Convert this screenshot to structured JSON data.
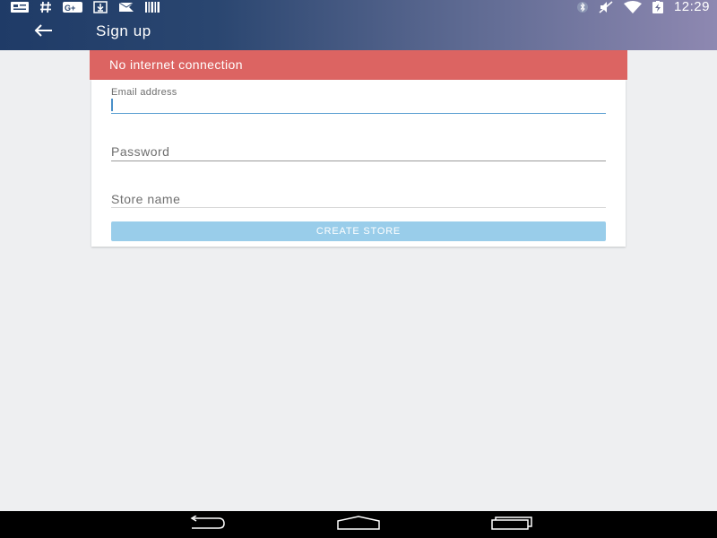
{
  "status_bar": {
    "time": "12:29",
    "left_icons": [
      "message-icon",
      "hashtag-icon",
      "google-plus-icon",
      "download-icon",
      "mail-icon",
      "barcode-icon"
    ],
    "right_icons": [
      "bluetooth-icon",
      "mute-icon",
      "wifi-icon",
      "battery-charging-icon"
    ]
  },
  "app_bar": {
    "title": "Sign up",
    "back_icon": "arrow-left-icon"
  },
  "banner": {
    "message": "No internet connection"
  },
  "form": {
    "email_label": "Email address",
    "email_value": "",
    "password_placeholder": "Password",
    "store_name_placeholder": "Store name",
    "submit_label": "CREATE STORE"
  },
  "nav_bar": {
    "icons": [
      "back-nav-icon",
      "home-nav-icon",
      "recents-nav-icon"
    ]
  },
  "colors": {
    "banner": "#dc6462",
    "button": "#99cdea",
    "background": "#eeeff1",
    "accent": "#5da0d2"
  }
}
